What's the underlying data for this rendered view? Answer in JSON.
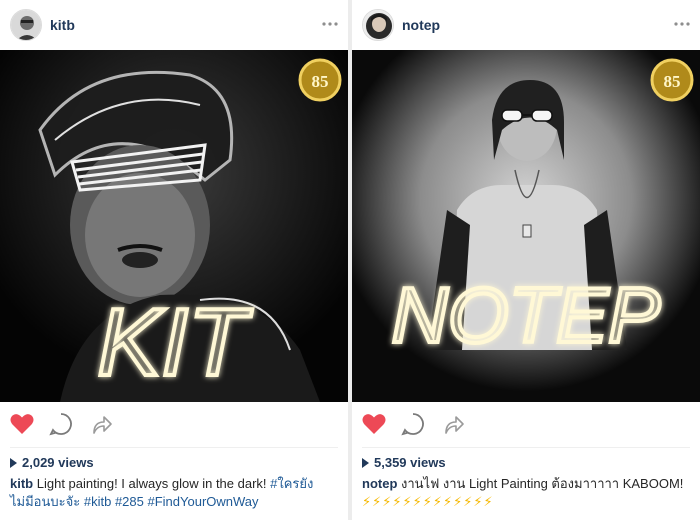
{
  "posts": [
    {
      "username": "kitb",
      "photo_text": "KIT",
      "badge": "85",
      "views": "2,029 views",
      "caption": {
        "user": "kitb",
        "text1": " Light painting! I always glow in the dark! ",
        "tag1": "#ใครยัง",
        "tag1b": "ไม่มีอนบะจัะ",
        "tag2": "#kitb",
        "tag3": "#285",
        "tag4": "#FindYourOwnWay"
      }
    },
    {
      "username": "notep",
      "photo_text": "NOTEP",
      "badge": "85",
      "views": "5,359 views",
      "caption": {
        "user": "notep",
        "text1": " งานไฟ งาน Light Painting ต้องมาาาาา KABOOM!",
        "emoji": "⚡⚡⚡⚡⚡⚡⚡⚡⚡⚡⚡⚡⚡"
      }
    }
  ],
  "icons": {
    "like": "heart-filled-red",
    "comment": "speech-bubble",
    "share": "share-arrow",
    "more": "ellipsis"
  },
  "colors": {
    "like": "#ed4956",
    "username": "#21395a",
    "hashtag": "#1f5a96"
  }
}
